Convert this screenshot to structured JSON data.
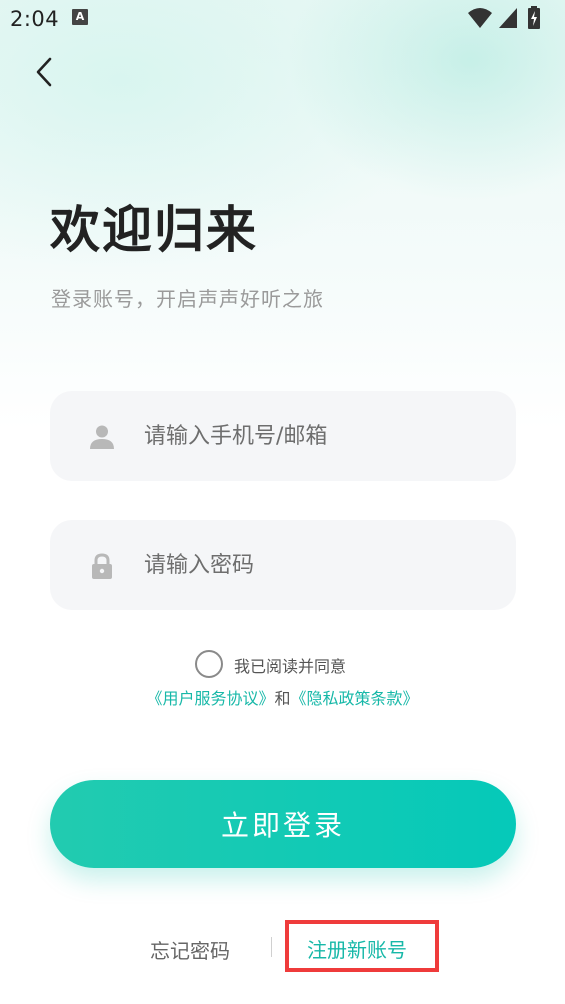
{
  "status_bar": {
    "time": "2:04",
    "notification_badge": "A"
  },
  "header": {
    "back_icon": "chevron-left-icon"
  },
  "main": {
    "title": "欢迎归来",
    "subtitle": "登录账号，开启声声好听之旅"
  },
  "form": {
    "account": {
      "placeholder": "请输入手机号/邮箱",
      "value": "",
      "icon": "user-icon"
    },
    "password": {
      "placeholder": "请输入密码",
      "value": "",
      "icon": "lock-icon"
    }
  },
  "agreement": {
    "checked": false,
    "text": "我已阅读并同意",
    "user_agreement": "《用户服务协议》",
    "conjunction": "和",
    "privacy_policy": "《隐私政策条款》"
  },
  "actions": {
    "login_label": "立即登录",
    "forgot_label": "忘记密码",
    "register_label": "注册新账号"
  },
  "colors": {
    "accent": "#17b8a8",
    "button_gradient_start": "#22cbb0",
    "button_gradient_end": "#05c9b9",
    "highlight_box": "#ef3b3b"
  }
}
